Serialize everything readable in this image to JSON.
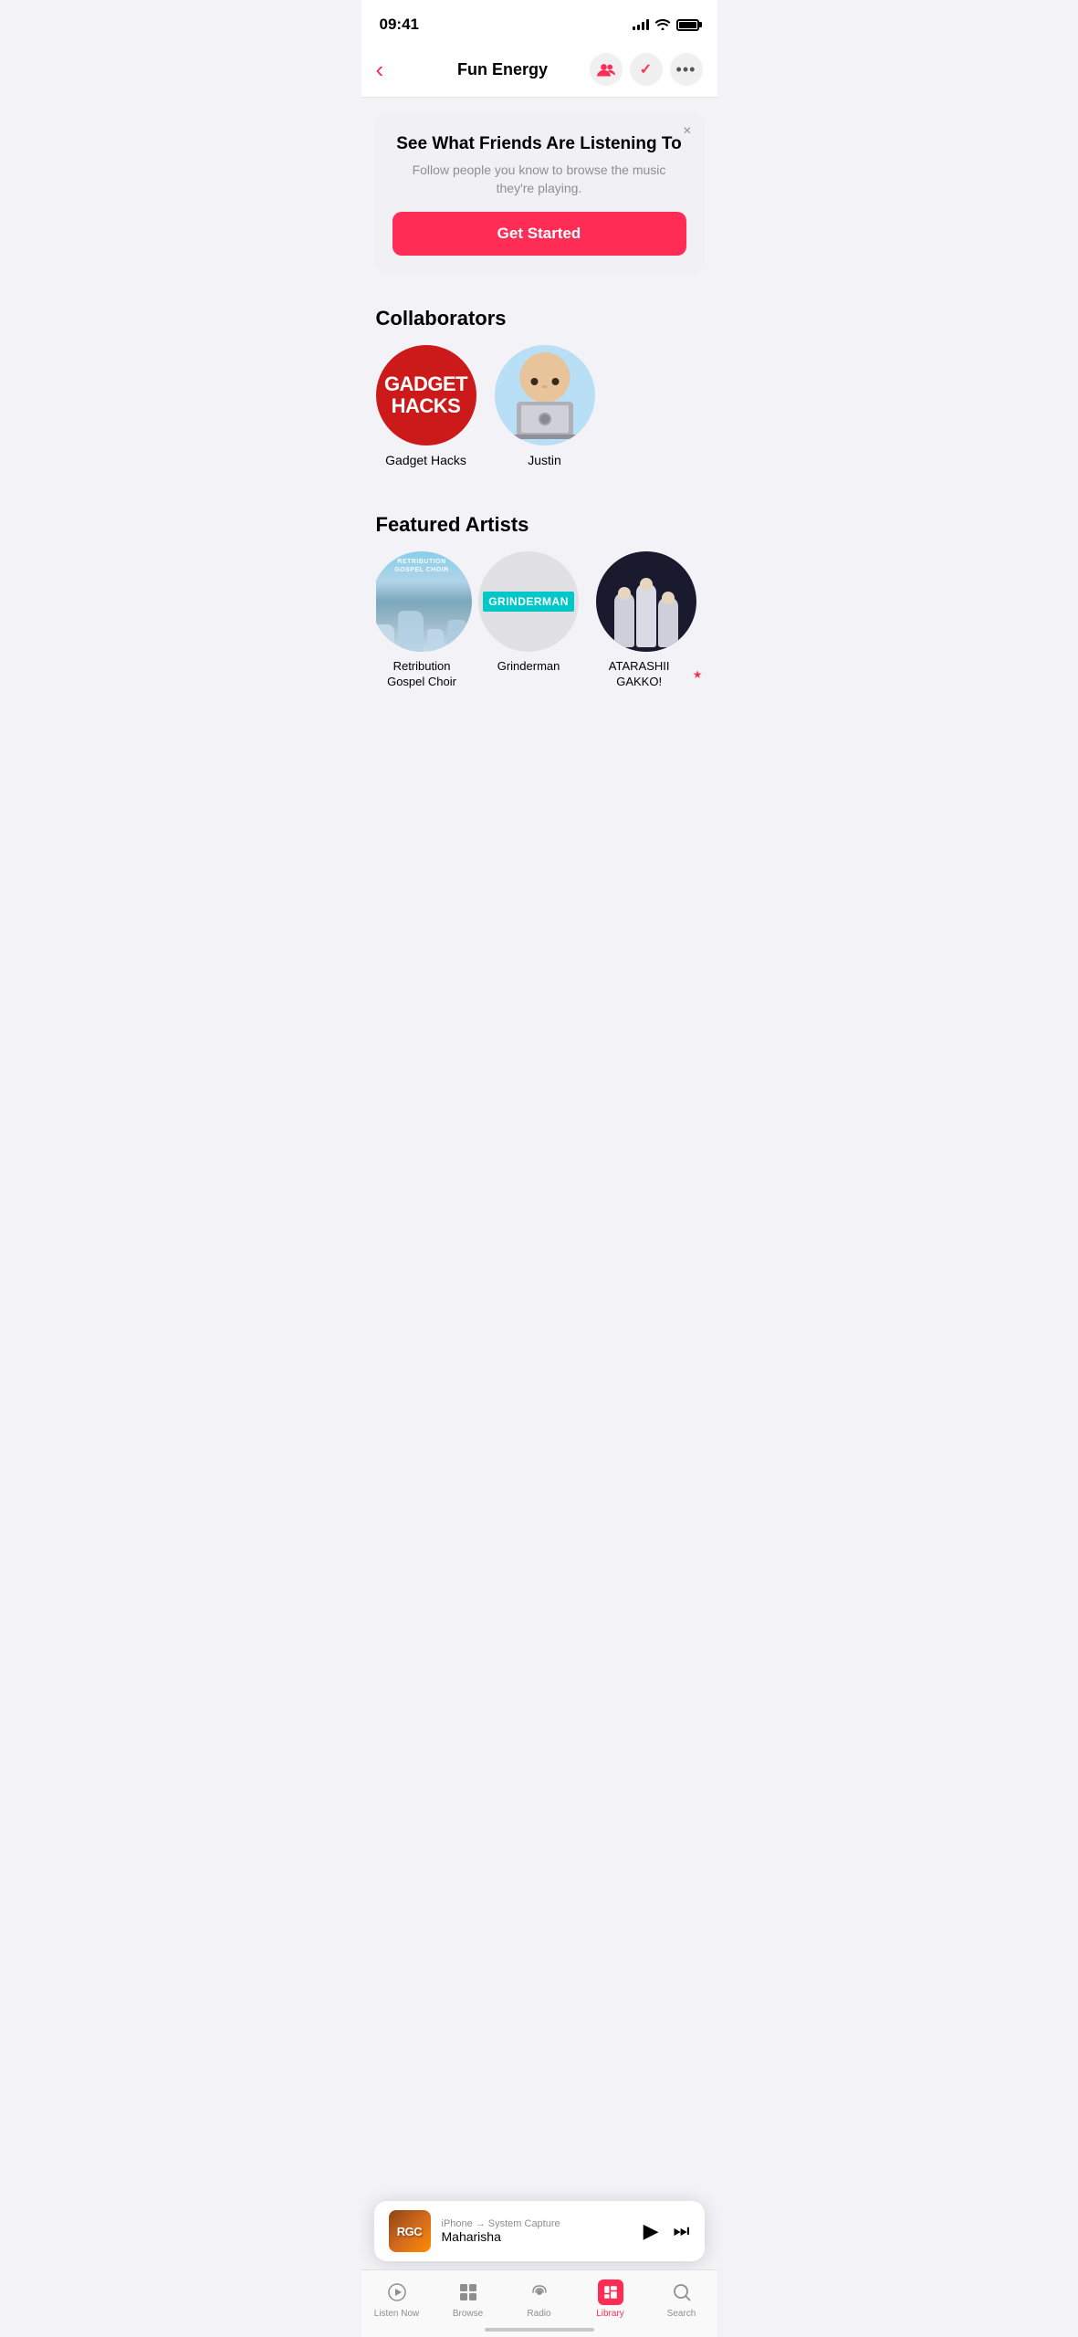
{
  "statusBar": {
    "time": "09:41",
    "signal": 4,
    "wifi": true,
    "battery": 100
  },
  "header": {
    "title": "Fun Energy",
    "backLabel": "‹",
    "actions": {
      "friendsIcon": "friends",
      "checkIcon": "✓",
      "moreIcon": "•••"
    }
  },
  "friendsBanner": {
    "closeLabel": "×",
    "title": "See What Friends Are Listening To",
    "subtitle": "Follow people you know to browse the music they're playing.",
    "buttonLabel": "Get Started"
  },
  "collaborators": {
    "sectionTitle": "Collaborators",
    "items": [
      {
        "name": "Gadget Hacks",
        "avatarType": "gadget-hacks",
        "avatarText": "GADGET\nHACKS"
      },
      {
        "name": "Justin",
        "avatarType": "justin",
        "avatarText": ""
      }
    ]
  },
  "featuredArtists": {
    "sectionTitle": "Featured Artists",
    "items": [
      {
        "name": "Retribution\nGospel Choir",
        "avatarType": "retribution",
        "featured": false
      },
      {
        "name": "Grinderman",
        "avatarType": "grinderman",
        "featured": false
      },
      {
        "name": "ATARASHII GAKKO!",
        "avatarType": "atarashii",
        "featured": true
      }
    ]
  },
  "nowPlaying": {
    "artType": "rgc",
    "source": "iPhone",
    "arrow": "→",
    "destination": "System Capture",
    "title": "Maharisha",
    "playIcon": "▶",
    "skipIcon": "⏭"
  },
  "tabBar": {
    "items": [
      {
        "id": "listen-now",
        "label": "Listen Now",
        "icon": "▶",
        "active": false
      },
      {
        "id": "browse",
        "label": "Browse",
        "icon": "⊞",
        "active": false
      },
      {
        "id": "radio",
        "label": "Radio",
        "icon": "📡",
        "active": false
      },
      {
        "id": "library",
        "label": "Library",
        "icon": "♪",
        "active": true
      },
      {
        "id": "search",
        "label": "Search",
        "icon": "⌕",
        "active": false
      }
    ]
  },
  "colors": {
    "accent": "#ff2d55",
    "background": "#f2f2f7",
    "cardBg": "#f0f0f5",
    "white": "#ffffff",
    "textPrimary": "#000000",
    "textSecondary": "#8e8e93"
  }
}
